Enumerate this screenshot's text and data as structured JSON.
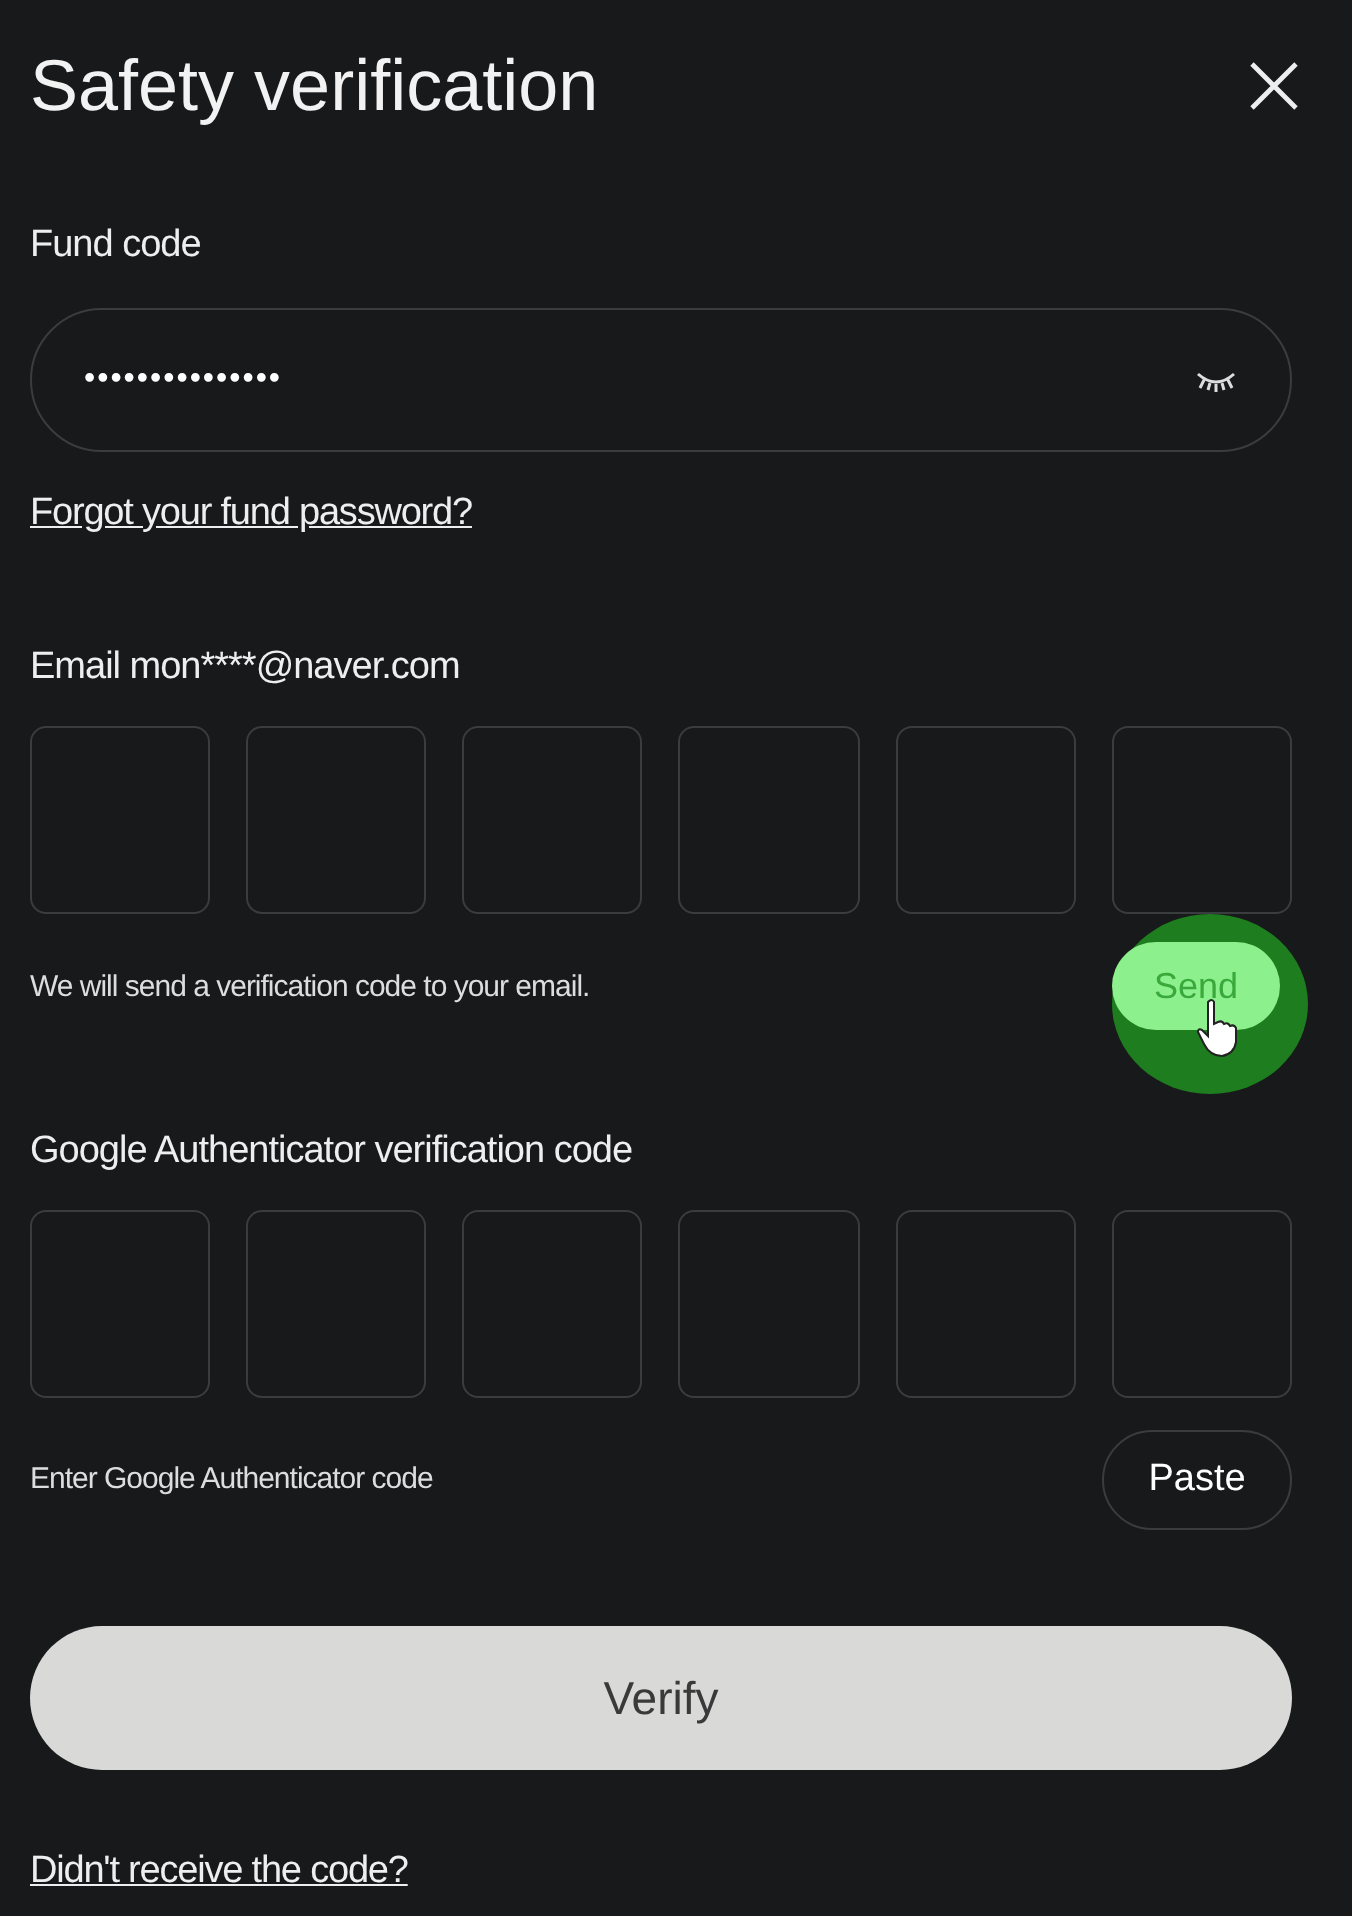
{
  "title": "Safety verification",
  "fund_code": {
    "label": "Fund code",
    "value": "•••••••••••••••"
  },
  "forgot_link": "Forgot your fund password?",
  "email": {
    "label": "Email mon****@naver.com",
    "hint": "We will send a verification code to your email.",
    "button": "Send"
  },
  "authenticator": {
    "label": "Google Authenticator verification code",
    "hint": "Enter Google Authenticator code",
    "button": "Paste"
  },
  "verify_button": "Verify",
  "resend_link": "Didn't receive the code?"
}
